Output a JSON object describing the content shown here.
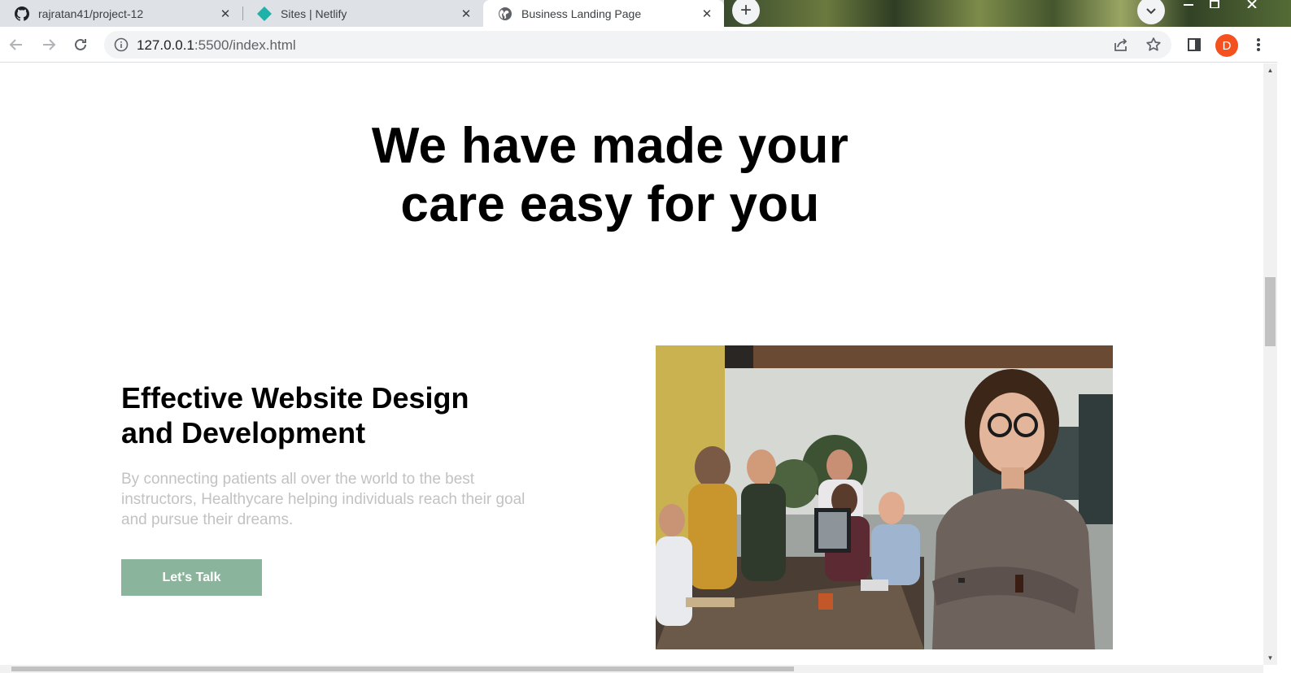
{
  "browser": {
    "tabs": [
      {
        "title": "rajratan41/project-12",
        "icon": "github-icon",
        "active": false
      },
      {
        "title": "Sites | Netlify",
        "icon": "netlify-icon",
        "active": false
      },
      {
        "title": "Business Landing Page",
        "icon": "globe-icon",
        "active": true
      }
    ],
    "close_glyph": "✕",
    "new_tab_glyph": "+",
    "url_host": "127.0.0.1",
    "url_rest": ":5500/index.html",
    "profile_initial": "D",
    "colors": {
      "tab_strip": "#dee1e6",
      "avatar": "#f4511e"
    }
  },
  "page": {
    "hero_title_line1": "We have made your",
    "hero_title_line2": "care easy for you",
    "section_title_line1": "Effective Website Design",
    "section_title_line2": "and Development",
    "section_description": "By connecting patients all over the world to the best instructors, Healthycare helping individuals reach their goal and pursue their dreams.",
    "cta_label": "Let's Talk",
    "colors": {
      "cta_background": "#8ab49c",
      "description_text": "#c2c2c2"
    }
  }
}
